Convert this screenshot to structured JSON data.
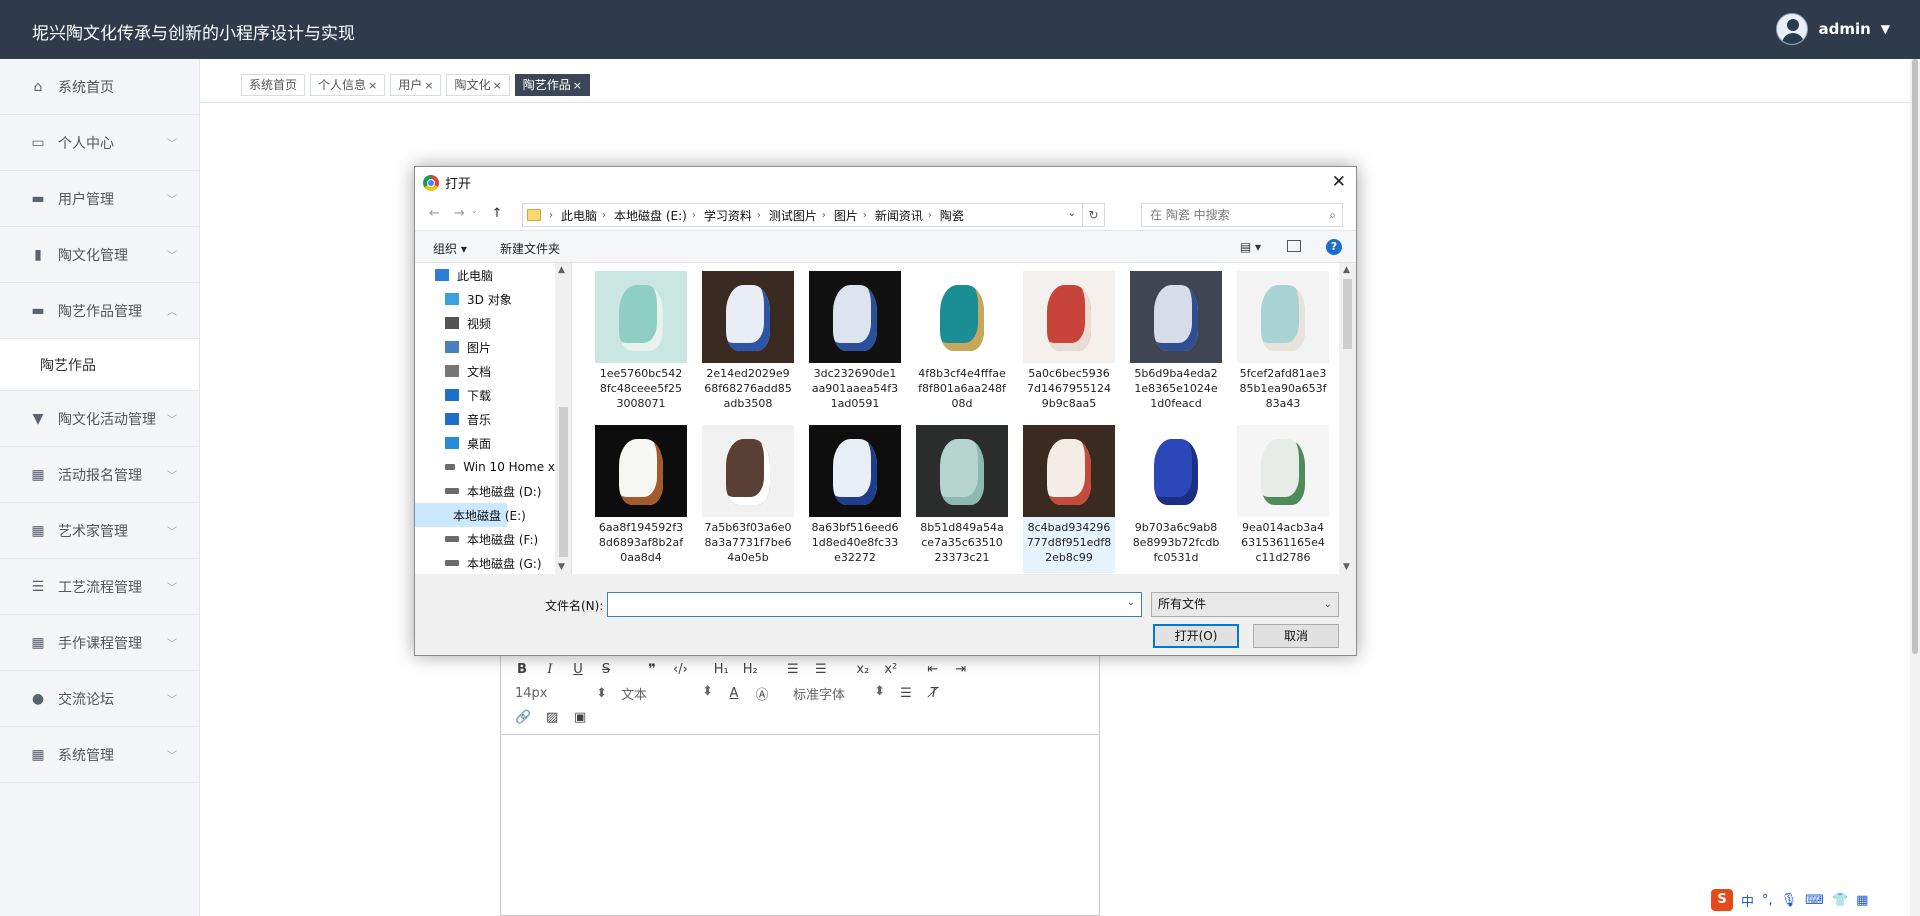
{
  "header": {
    "title": "坭兴陶文化传承与创新的小程序设计与实现",
    "username": "admin"
  },
  "sidebar": {
    "items": [
      {
        "label": "系统首页",
        "icon": "home-icon",
        "expandable": false
      },
      {
        "label": "个人中心",
        "icon": "profile-icon",
        "expandable": true
      },
      {
        "label": "用户管理",
        "icon": "monitor-icon",
        "expandable": true
      },
      {
        "label": "陶文化管理",
        "icon": "clipboard-icon",
        "expandable": true
      },
      {
        "label": "陶艺作品管理",
        "icon": "monitor-icon",
        "expandable": true,
        "expanded": true
      },
      {
        "label": "陶文化活动管理",
        "icon": "pin-icon",
        "expandable": true
      },
      {
        "label": "活动报名管理",
        "icon": "grid-icon",
        "expandable": true
      },
      {
        "label": "艺术家管理",
        "icon": "grid-icon",
        "expandable": true
      },
      {
        "label": "工艺流程管理",
        "icon": "list-icon",
        "expandable": true
      },
      {
        "label": "手作课程管理",
        "icon": "grid-icon",
        "expandable": true
      },
      {
        "label": "交流论坛",
        "icon": "bulb-icon",
        "expandable": true
      },
      {
        "label": "系统管理",
        "icon": "grid-icon",
        "expandable": true
      }
    ],
    "subitem": "陶艺作品"
  },
  "tabs": [
    {
      "label": "系统首页",
      "closable": false
    },
    {
      "label": "个人信息",
      "closable": true
    },
    {
      "label": "用户",
      "closable": true
    },
    {
      "label": "陶文化",
      "closable": true
    },
    {
      "label": "陶艺作品",
      "closable": true,
      "active": true
    }
  ],
  "editor": {
    "font_size": "14px",
    "text_type": "文本",
    "font_family": "标准字体"
  },
  "dialog": {
    "title": "打开",
    "breadcrumbs": [
      "此电脑",
      "本地磁盘 (E:)",
      "学习资料",
      "测试图片",
      "图片",
      "新闻资讯",
      "陶瓷"
    ],
    "search_placeholder": "在 陶瓷 中搜索",
    "organize": "组织 ▾",
    "new_folder": "新建文件夹",
    "tree": [
      {
        "label": "此电脑",
        "icon": "computer-icon"
      },
      {
        "label": "3D 对象",
        "icon": "cube-icon"
      },
      {
        "label": "视频",
        "icon": "video-icon"
      },
      {
        "label": "图片",
        "icon": "picture-icon"
      },
      {
        "label": "文档",
        "icon": "document-icon"
      },
      {
        "label": "下载",
        "icon": "download-icon"
      },
      {
        "label": "音乐",
        "icon": "music-icon"
      },
      {
        "label": "桌面",
        "icon": "desktop-icon"
      },
      {
        "label": "Win 10 Home x",
        "icon": "drive-icon"
      },
      {
        "label": "本地磁盘 (D:)",
        "icon": "drive-icon"
      },
      {
        "label": "本地磁盘 (E:)",
        "icon": "drive-icon",
        "selected": true
      },
      {
        "label": "本地磁盘 (F:)",
        "icon": "drive-icon"
      },
      {
        "label": "本地磁盘 (G:)",
        "icon": "drive-icon"
      }
    ],
    "files": [
      {
        "name": "1ee5760bc5428fc48ceee5f253008071",
        "colors": [
          "#c9e6e0",
          "#8fcfc2",
          "#e8f2ef"
        ]
      },
      {
        "name": "2e14ed2029e968f68276add85adb3508",
        "colors": [
          "#3b2a22",
          "#e9eef6",
          "#2c55a8"
        ]
      },
      {
        "name": "3dc232690de1aa901aaea54f31ad0591",
        "colors": [
          "#111111",
          "#dde4ef",
          "#2b4f9a"
        ]
      },
      {
        "name": "4f8b3cf4e4fffaef8f801a6aa248f08d",
        "colors": [
          "#ffffff",
          "#1b8e94",
          "#c9a75a"
        ]
      },
      {
        "name": "5a0c6bec59367d14679551249b9c8aa5",
        "colors": [
          "#f4f0ee",
          "#c8443b",
          "#e9dcd5"
        ]
      },
      {
        "name": "5b6d9ba4eda21e8365e1024e1d0feacd",
        "colors": [
          "#404552",
          "#d7dde8",
          "#2f4f93"
        ]
      },
      {
        "name": "5fcef2afd81ae385b1ea90a653f83a43",
        "colors": [
          "#f3f3f3",
          "#a8d3d2",
          "#e8e3dd"
        ]
      },
      {
        "name": "6aa8f194592f38d6893af8b2af0aa8d4",
        "colors": [
          "#0d0d0d",
          "#f6f6f2",
          "#a35b2c"
        ]
      },
      {
        "name": "7a5b63f03a6e08a3a7731f7be64a0e5b",
        "colors": [
          "#f1f1f1",
          "#5a3f33",
          "#ffffff"
        ]
      },
      {
        "name": "8a63bf516eed61d8ed40e8fc33e32272",
        "colors": [
          "#0e0e0e",
          "#eaeef5",
          "#1e3d8a"
        ]
      },
      {
        "name": "8b51d849a54ace7a35c6351023373c21",
        "colors": [
          "#2a2d2b",
          "#b6d5cf",
          "#8fb8b1"
        ]
      },
      {
        "name": "8c4bad934296777d8f951edf82eb8c99",
        "colors": [
          "#3a2a20",
          "#f3ede6",
          "#c44b3c"
        ],
        "hover": true
      },
      {
        "name": "9b703a6c9ab88e8993b72fcdbfc0531d",
        "colors": [
          "#ffffff",
          "#2c47b8",
          "#1d2f82"
        ]
      },
      {
        "name": "9ea014acb3a46315361165e4c11d2786",
        "colors": [
          "#f5f5f5",
          "#e7ece8",
          "#4f8a5a"
        ]
      }
    ],
    "filename_label": "文件名(N):",
    "filename_value": "",
    "filetype": "所有文件",
    "open_label": "打开(O)",
    "cancel_label": "取消"
  },
  "ime": {
    "mode": "中"
  }
}
